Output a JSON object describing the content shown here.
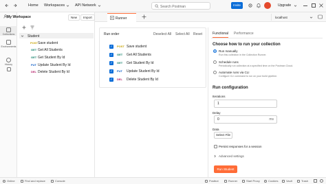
{
  "topbar": {
    "home": "Home",
    "workspaces": "Workspaces",
    "api_network": "API Network",
    "search_placeholder": "Search Postman",
    "invite": "Invite",
    "upgrade": "Upgrade"
  },
  "sidebar": {
    "workspace_name": "My Workspace",
    "new_label": "New",
    "import_label": "Import",
    "rail": [
      {
        "label": "Collections"
      },
      {
        "label": "Environments"
      },
      {
        "label": "History"
      }
    ],
    "collection_name": "Student",
    "requests": [
      {
        "method": "POST",
        "name": "Save student"
      },
      {
        "method": "GET",
        "name": "Get All Students"
      },
      {
        "method": "GET",
        "name": "Get Student By Id"
      },
      {
        "method": "PUT",
        "name": "Update Student By Id"
      },
      {
        "method": "DEL",
        "name": "Delete Student By Id"
      }
    ]
  },
  "tabs": {
    "active_tab": "Runner",
    "environment": "localhost"
  },
  "runner": {
    "run_order_label": "Run order",
    "deselect_all": "Deselect All",
    "select_all": "Select All",
    "reset": "Reset",
    "requests": [
      {
        "method": "POST",
        "name": "Save student"
      },
      {
        "method": "GET",
        "name": "Get All Students"
      },
      {
        "method": "GET",
        "name": "Get Student By Id"
      },
      {
        "method": "PUT",
        "name": "Update Student By Id"
      },
      {
        "method": "DEL",
        "name": "Delete Student By Id"
      }
    ]
  },
  "config": {
    "tab_functional": "Functional",
    "tab_performance": "Performance",
    "choose_heading": "Choose how to run your collection",
    "options": [
      {
        "title": "Run manually",
        "desc": "Run this collection in the Collection Runner."
      },
      {
        "title": "Schedule runs",
        "desc": "Periodically run collection at a specified time on the Postman Cloud."
      },
      {
        "title": "Automate runs via CLI",
        "desc": "Configure CLI command to run on your build pipeline."
      }
    ],
    "run_config_heading": "Run configuration",
    "iterations_label": "Iterations",
    "iterations_value": "1",
    "delay_label": "Delay",
    "delay_value": "0",
    "delay_unit": "ms",
    "data_label": "Data",
    "select_file": "Select File",
    "persist_label": "Persist responses for a session",
    "advanced_label": "Advanced settings",
    "run_button": "Run Student"
  },
  "statusbar": {
    "online": "Online",
    "find_replace": "Find and replace",
    "console": "Console",
    "postbot": "Postbot",
    "runner": "Runner",
    "start_proxy": "Start Proxy",
    "cookies": "Cookies",
    "vault": "Vault",
    "trash": "Trash"
  },
  "colors": {
    "accent": "#0b6dd8",
    "run_button": "#ff6c37",
    "method_post": "#c7a200",
    "method_get": "#12806a",
    "method_put": "#0b5cc7",
    "method_del": "#b5226b"
  }
}
